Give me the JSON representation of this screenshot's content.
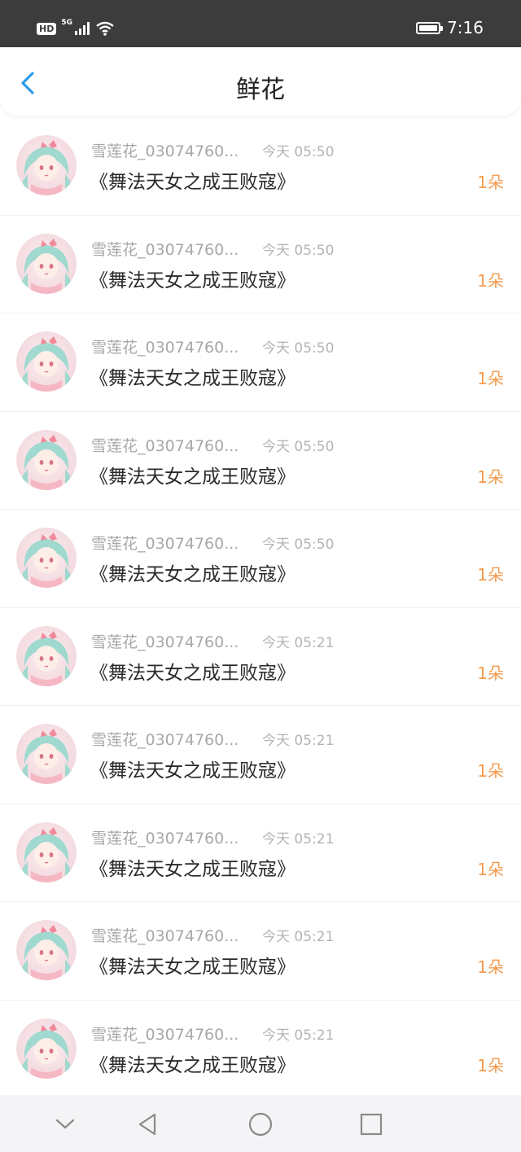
{
  "status_bar": {
    "hd": "HD",
    "network": "5G",
    "time": "7:16"
  },
  "header": {
    "title": "鲜花",
    "back_icon": "chevron-left-icon"
  },
  "items": [
    {
      "name": "雪莲花_03074760...",
      "time": "今天 05:50",
      "book": "《舞法天女之成王败寇》",
      "amount": "1朵"
    },
    {
      "name": "雪莲花_03074760...",
      "time": "今天 05:50",
      "book": "《舞法天女之成王败寇》",
      "amount": "1朵"
    },
    {
      "name": "雪莲花_03074760...",
      "time": "今天 05:50",
      "book": "《舞法天女之成王败寇》",
      "amount": "1朵"
    },
    {
      "name": "雪莲花_03074760...",
      "time": "今天 05:50",
      "book": "《舞法天女之成王败寇》",
      "amount": "1朵"
    },
    {
      "name": "雪莲花_03074760...",
      "time": "今天 05:50",
      "book": "《舞法天女之成王败寇》",
      "amount": "1朵"
    },
    {
      "name": "雪莲花_03074760...",
      "time": "今天 05:21",
      "book": "《舞法天女之成王败寇》",
      "amount": "1朵"
    },
    {
      "name": "雪莲花_03074760...",
      "time": "今天 05:21",
      "book": "《舞法天女之成王败寇》",
      "amount": "1朵"
    },
    {
      "name": "雪莲花_03074760...",
      "time": "今天 05:21",
      "book": "《舞法天女之成王败寇》",
      "amount": "1朵"
    },
    {
      "name": "雪莲花_03074760...",
      "time": "今天 05:21",
      "book": "《舞法天女之成王败寇》",
      "amount": "1朵"
    },
    {
      "name": "雪莲花_03074760...",
      "time": "今天 05:21",
      "book": "《舞法天女之成王败寇》",
      "amount": "1朵"
    }
  ],
  "colors": {
    "accent": "#2f9be8",
    "amount": "#f39a4e",
    "status_bar": "#3c3c3c"
  },
  "nav": {
    "icons": [
      "chevron-down-icon",
      "back-triangle-icon",
      "home-circle-icon",
      "recents-square-icon"
    ]
  }
}
